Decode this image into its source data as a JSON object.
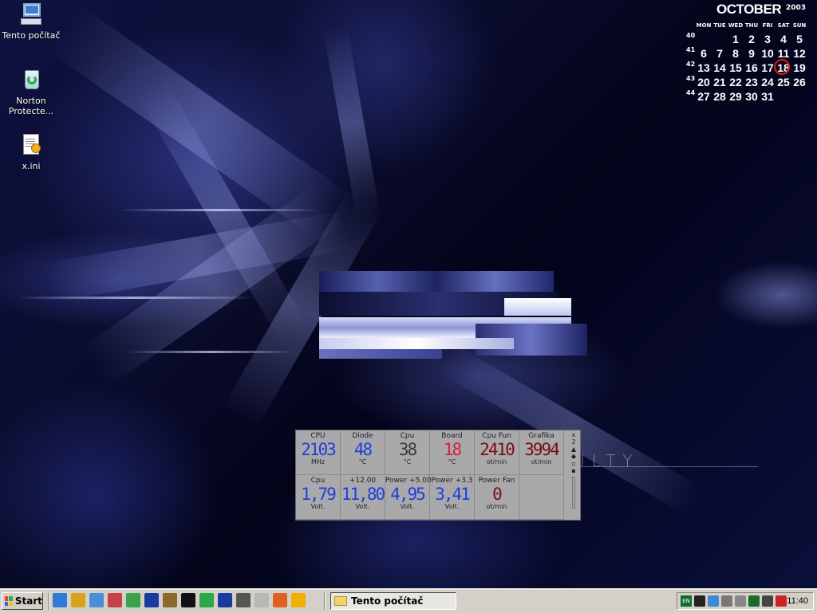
{
  "desktop": {
    "icons": [
      {
        "label": "Tento počítač",
        "icon": "my-computer-icon"
      },
      {
        "label": "Norton Protecte...",
        "icon": "recycle-bin-icon"
      },
      {
        "label": "x.ini",
        "icon": "ini-file-icon"
      }
    ],
    "watermark": "DIFFICULTY"
  },
  "calendar": {
    "month": "OCTOBER",
    "year": "2003",
    "weekdays": [
      "MON",
      "TUE",
      "WED",
      "THU",
      "FRI",
      "SAT",
      "SUN"
    ],
    "weeks": [
      {
        "no": "40",
        "days": [
          "",
          "",
          "1",
          "2",
          "3",
          "4",
          "5"
        ]
      },
      {
        "no": "41",
        "days": [
          "6",
          "7",
          "8",
          "9",
          "10",
          "11",
          "12"
        ]
      },
      {
        "no": "42",
        "days": [
          "13",
          "14",
          "15",
          "16",
          "17",
          "18",
          "19"
        ]
      },
      {
        "no": "43",
        "days": [
          "20",
          "21",
          "22",
          "23",
          "24",
          "25",
          "26"
        ]
      },
      {
        "no": "44",
        "days": [
          "27",
          "28",
          "29",
          "30",
          "31",
          "",
          ""
        ]
      }
    ],
    "today": "18",
    "highlight_color": "#e21a1a"
  },
  "monitor": {
    "row1": [
      {
        "label": "CPU",
        "value": "2103",
        "unit": "MHz",
        "color": "blue"
      },
      {
        "label": "Diode",
        "value": "48",
        "unit": "°C",
        "color": "blue"
      },
      {
        "label": "Cpu",
        "value": "38",
        "unit": "°C",
        "color": "gray"
      },
      {
        "label": "Board",
        "value": "18",
        "unit": "°C",
        "color": "red"
      },
      {
        "label": "Cpu Fun",
        "value": "2410",
        "unit": "ot/min",
        "color": "dred"
      },
      {
        "label": "Grafika",
        "value": "3994",
        "unit": "ot/min",
        "color": "dred"
      }
    ],
    "row2": [
      {
        "label": "Cpu",
        "value": "1,79",
        "unit": "Volt.",
        "color": "blue"
      },
      {
        "label": "+12.00",
        "value": "11,80",
        "unit": "Volt.",
        "color": "blue"
      },
      {
        "label": "Power +5.00",
        "value": "4,95",
        "unit": "Volt.",
        "color": "blue"
      },
      {
        "label": "Power +3.3",
        "value": "3,41",
        "unit": "Volt.",
        "color": "blue"
      },
      {
        "label": "Power Fan",
        "value": "0",
        "unit": "ot/min",
        "color": "dred"
      }
    ],
    "controls": {
      "close": "x",
      "page": "2"
    }
  },
  "taskbar": {
    "start_label": "Start",
    "quick_launch": [
      "network-icon",
      "search-icon",
      "pencil-icon",
      "media-icon",
      "people-icon",
      "winamp-icon",
      "package-icon",
      "vc-icon",
      "refresh-icon",
      "save-icon",
      "film-icon",
      "document-icon",
      "fish-icon",
      "fish-icon-2"
    ],
    "task_button": "Tento počítač",
    "tray": [
      "keyboard-en-icon",
      "speaker-icon",
      "network-icon",
      "display-icon",
      "chip-icon",
      "volume-icon",
      "monitor-icon",
      "pen-icon"
    ],
    "tray_lang": "EN",
    "clock": "11:40"
  }
}
